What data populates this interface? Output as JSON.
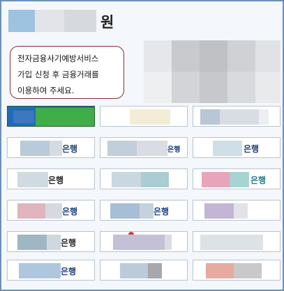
{
  "header": {
    "title_suffix": "원"
  },
  "notice": {
    "lines": [
      "전자금융사기예방서비스",
      "가입 신청 후 금융거래를",
      "이용하여 주세요."
    ]
  },
  "banks": [
    {
      "label": ""
    },
    {
      "label": ""
    },
    {
      "label": ""
    },
    {
      "label": "은행"
    },
    {
      "label": "은행"
    },
    {
      "label": "은행"
    },
    {
      "label": "은행"
    },
    {
      "label": ""
    },
    {
      "label": "은행"
    },
    {
      "label": "은행"
    },
    {
      "label": "은행"
    },
    {
      "label": ""
    },
    {
      "label": "은행"
    },
    {
      "label": ""
    },
    {
      "label": ""
    },
    {
      "label": "은행"
    },
    {
      "label": ""
    },
    {
      "label": ""
    }
  ],
  "colors": {
    "frame_border": "#6c8fb8",
    "notice_border": "#8d2a3b",
    "bank_label": "#1c3f7a"
  }
}
